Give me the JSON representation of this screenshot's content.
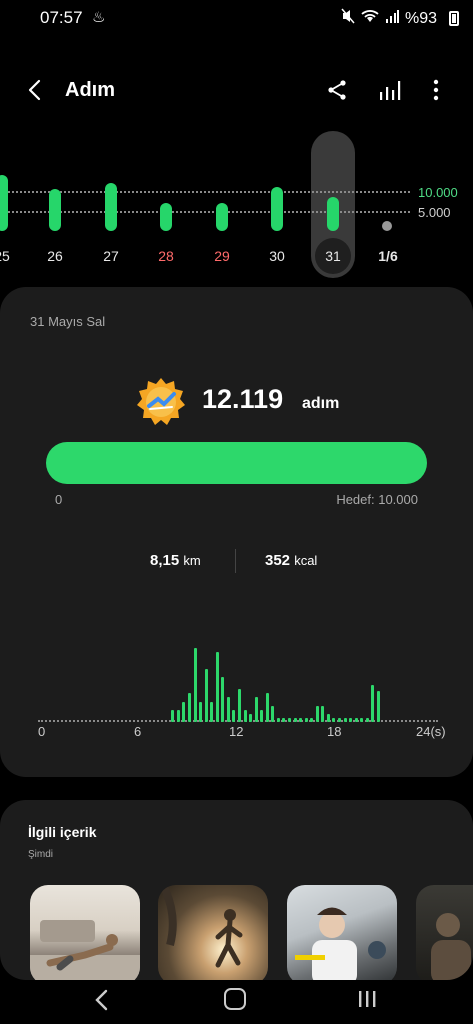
{
  "status": {
    "time": "07:57",
    "battery": "%93"
  },
  "header": {
    "title": "Adım"
  },
  "week_chart": {
    "reference_high": "10.000",
    "reference_low": "5.000",
    "days": [
      {
        "label": "25",
        "steps": 14000,
        "weekend": false
      },
      {
        "label": "26",
        "steps": 10500,
        "weekend": false
      },
      {
        "label": "27",
        "steps": 12000,
        "weekend": false
      },
      {
        "label": "28",
        "steps": 7000,
        "weekend": true
      },
      {
        "label": "29",
        "steps": 7000,
        "weekend": true
      },
      {
        "label": "30",
        "steps": 11000,
        "weekend": false
      },
      {
        "label": "31",
        "steps": 8500,
        "weekend": false,
        "selected": true
      },
      {
        "label": "1/6",
        "steps": 0,
        "weekend": false,
        "future": true
      }
    ]
  },
  "summary": {
    "date": "31 Mayıs Sal",
    "steps": "12.119",
    "steps_unit": "adım",
    "progress_fraction": 1.0,
    "progress_min": "0",
    "progress_goal": "Hedef: 10.000",
    "distance": "8,15",
    "distance_unit": "km",
    "calories": "352",
    "calories_unit": "kcal"
  },
  "hourly_chart": {
    "labels": [
      "0",
      "6",
      "12",
      "18",
      "24(s)"
    ],
    "values": [
      0,
      0,
      0,
      0,
      0,
      0,
      0,
      0,
      0,
      0,
      0,
      0,
      0,
      0,
      0,
      0,
      0,
      0,
      0,
      0,
      0,
      0,
      0,
      0,
      0.15,
      0.15,
      0.25,
      0.35,
      0.9,
      0.25,
      0.65,
      0.25,
      0.85,
      0.55,
      0.3,
      0.15,
      0.4,
      0.15,
      0.1,
      0.3,
      0.15,
      0.35,
      0.2,
      0.05,
      0.05,
      0.05,
      0.05,
      0.05,
      0.05,
      0.05,
      0.2,
      0.2,
      0.1,
      0.05,
      0.05,
      0.05,
      0.05,
      0.05,
      0.05,
      0.05,
      0.45,
      0.38,
      0,
      0,
      0,
      0,
      0,
      0,
      0,
      0,
      0,
      0
    ]
  },
  "related": {
    "title": "İlgili içerik",
    "subtitle": "Şimdi"
  },
  "colors": {
    "accent": "#26d66a",
    "weekend": "#ff6b6b",
    "card": "#1c1c1c"
  }
}
